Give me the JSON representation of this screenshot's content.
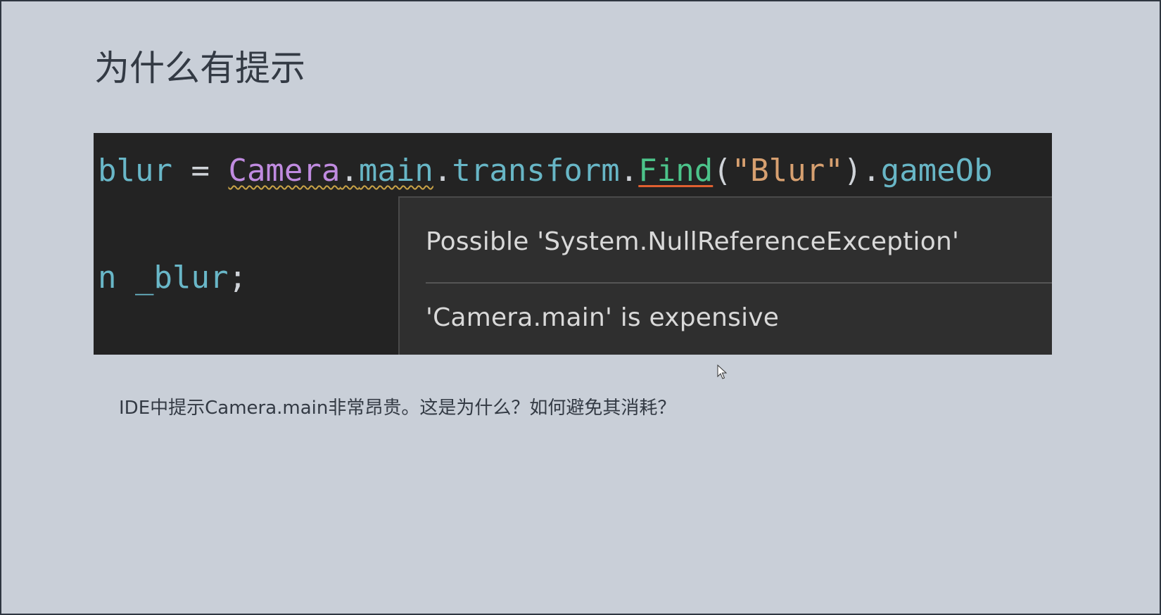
{
  "slide": {
    "title": "为什么有提示",
    "caption": "IDE中提示Camera.main非常昂贵。这是为什么？如何避免其消耗？"
  },
  "code_screenshot": {
    "line1": {
      "var": "blur",
      "assign": " = ",
      "camera": "Camera",
      "dot1": ".",
      "main": "main",
      "dot2": ".",
      "transform": "transform",
      "dot3": ".",
      "find": "Find",
      "open": "(",
      "string": "\"Blur\"",
      "close": ")",
      "dot4": ".",
      "tail": "gameOb"
    },
    "line2": {
      "prefix": "n ",
      "var": "_blur",
      "semicolon": ";"
    },
    "tooltip": {
      "warning_1": "Possible 'System.NullReferenceException'",
      "warning_2": "'Camera.main' is expensive"
    }
  },
  "colors": {
    "slide_background": "#c9cfd8",
    "code_background": "#232323",
    "tooltip_background": "#2f2f2f",
    "class_token": "#c08be0",
    "method_token": "#4cc38a",
    "string_token": "#d7a070"
  },
  "icons": {
    "cursor": "mouse-pointer-icon"
  }
}
